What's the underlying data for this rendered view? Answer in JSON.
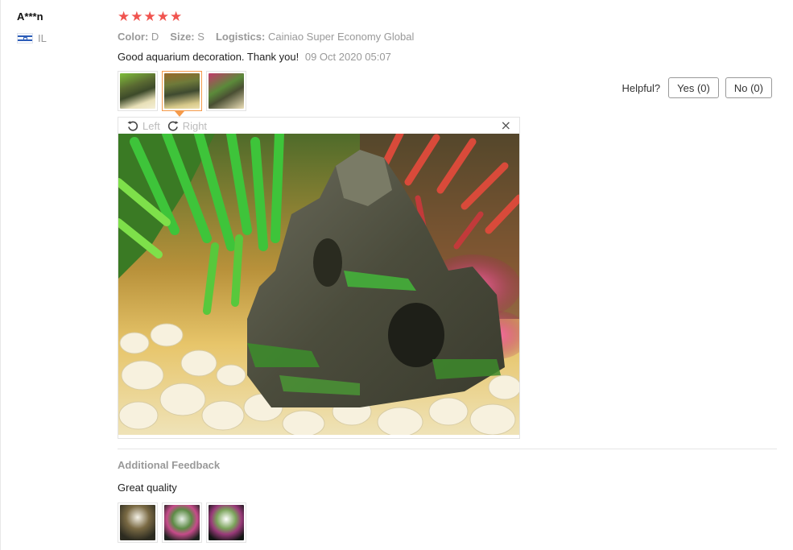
{
  "user": {
    "name": "A***n",
    "country": "IL"
  },
  "review": {
    "rating": 5,
    "stars": [
      "★",
      "★",
      "★",
      "★",
      "★"
    ],
    "attributes": [
      {
        "key": "Color:",
        "value": "D"
      },
      {
        "key": "Size:",
        "value": "S"
      },
      {
        "key": "Logistics:",
        "value": "Cainiao Super Economy Global"
      }
    ],
    "text": "Good aquarium decoration. Thank you!",
    "date": "09 Oct 2020 05:07",
    "thumbnail_count": 3,
    "active_thumbnail": 2
  },
  "helpful": {
    "label": "Helpful?",
    "yes": "Yes (0)",
    "no": "No (0)"
  },
  "viewer": {
    "rotate_left": "Left",
    "rotate_right": "Right",
    "close": "×"
  },
  "additional": {
    "title": "Additional Feedback",
    "text": "Great quality",
    "thumbnail_count": 3
  },
  "colors": {
    "star": "#f0544f",
    "active_thumb": "#f59a4a"
  }
}
